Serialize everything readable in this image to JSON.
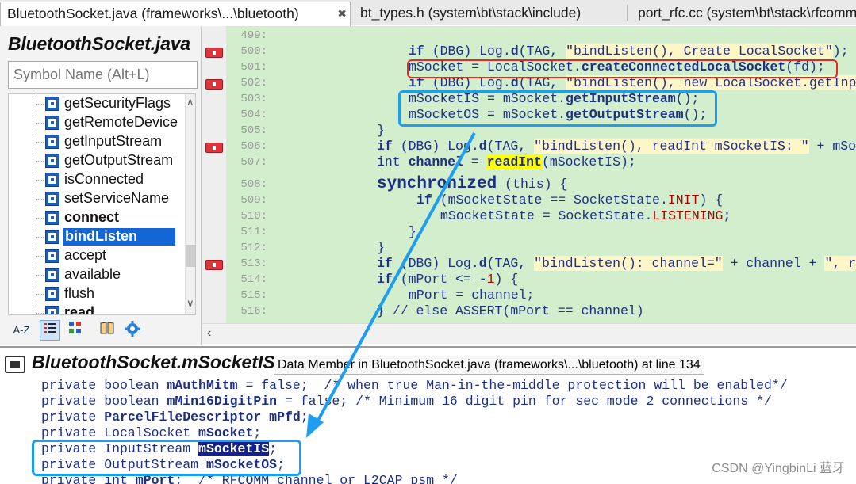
{
  "tabs": [
    {
      "label": "BluetoothSocket.java (frameworks\\...\\bluetooth)",
      "active": true,
      "close": "✖"
    },
    {
      "label": "bt_types.h (system\\bt\\stack\\include)",
      "active": false
    },
    {
      "label": "port_rfc.cc (system\\bt\\stack\\rfcomm)",
      "active": false
    }
  ],
  "symbols": {
    "title": "BluetoothSocket.java",
    "search_placeholder": "Symbol Name (Alt+L)",
    "items": [
      {
        "label": "getSecurityFlags",
        "bold": false
      },
      {
        "label": "getRemoteDevice",
        "bold": false
      },
      {
        "label": "getInputStream",
        "bold": false
      },
      {
        "label": "getOutputStream",
        "bold": false
      },
      {
        "label": "isConnected",
        "bold": false
      },
      {
        "label": "setServiceName",
        "bold": false
      },
      {
        "label": "connect",
        "bold": true
      },
      {
        "label": "bindListen",
        "bold": true,
        "selected": true
      },
      {
        "label": "accept",
        "bold": false
      },
      {
        "label": "available",
        "bold": false
      },
      {
        "label": "flush",
        "bold": false
      },
      {
        "label": "read",
        "bold": true
      }
    ],
    "toolbar": {
      "az": "A-Z",
      "up": "∧",
      "down": "∨",
      "left": "‹"
    }
  },
  "editor": {
    "lines": [
      {
        "no": "499:",
        "segs": []
      },
      {
        "no": "500:",
        "segs": [
          [
            "kw",
            "if"
          ],
          [
            "plain",
            " (DBG) "
          ],
          [
            "plain",
            "Log."
          ],
          [
            "fn",
            "d"
          ],
          [
            "plain",
            "(TAG, "
          ],
          [
            "str",
            "\"bindListen(), Create LocalSocket\""
          ],
          [
            "plain",
            ");"
          ]
        ]
      },
      {
        "no": "501:",
        "segs": [
          [
            "plain",
            "mSocket = LocalSocket."
          ],
          [
            "fn",
            "createConnectedLocalSocket"
          ],
          [
            "plain",
            "(fd);"
          ]
        ]
      },
      {
        "no": "502:",
        "segs": [
          [
            "kw",
            "if"
          ],
          [
            "plain",
            " (DBG) Log."
          ],
          [
            "fn",
            "d"
          ],
          [
            "plain",
            "(TAG, "
          ],
          [
            "str",
            "\"bindListen(), new LocalSocket.getInp"
          ]
        ]
      },
      {
        "no": "503:",
        "segs": [
          [
            "plain",
            "mSocketIS = mSocket."
          ],
          [
            "fn",
            "getInputStream"
          ],
          [
            "plain",
            "();"
          ]
        ]
      },
      {
        "no": "504:",
        "segs": [
          [
            "plain",
            "mSocketOS = mSocket."
          ],
          [
            "fn",
            "getOutputStream"
          ],
          [
            "plain",
            "();"
          ]
        ]
      },
      {
        "no": "505:",
        "segs": [
          [
            "plain",
            "}"
          ]
        ]
      },
      {
        "no": "506:",
        "segs": [
          [
            "kw",
            "if"
          ],
          [
            "plain",
            " (DBG) Log."
          ],
          [
            "fn",
            "d"
          ],
          [
            "plain",
            "(TAG, "
          ],
          [
            "str",
            "\"bindListen(), readInt mSocketIS: \""
          ],
          [
            "plain",
            " + mSo"
          ]
        ]
      },
      {
        "no": "507:",
        "segs": [
          [
            "plain",
            "int "
          ],
          [
            "kw",
            "channel"
          ],
          [
            "plain",
            " = "
          ],
          [
            "hl",
            "readInt"
          ],
          [
            "plain",
            "(mSocketIS);"
          ]
        ]
      },
      {
        "no": "508:",
        "segs": [
          [
            "sync",
            "synchronized"
          ],
          [
            "plain",
            " (this) {"
          ]
        ]
      },
      {
        "no": "509:",
        "segs": [
          [
            "kw",
            "if"
          ],
          [
            "plain",
            " (mSocketState == SocketState."
          ],
          [
            "const",
            "INIT"
          ],
          [
            "plain",
            ") {"
          ]
        ]
      },
      {
        "no": "510:",
        "segs": [
          [
            "plain",
            "mSocketState = SocketState."
          ],
          [
            "const",
            "LISTENING"
          ],
          [
            "plain",
            ";"
          ]
        ]
      },
      {
        "no": "511:",
        "segs": [
          [
            "plain",
            "}"
          ]
        ]
      },
      {
        "no": "512:",
        "segs": [
          [
            "plain",
            "}"
          ]
        ]
      },
      {
        "no": "513:",
        "segs": [
          [
            "kw",
            "if"
          ],
          [
            "plain",
            " (DBG) Log."
          ],
          [
            "fn",
            "d"
          ],
          [
            "plain",
            "(TAG, "
          ],
          [
            "str",
            "\"bindListen(): channel=\""
          ],
          [
            "plain",
            " + channel + "
          ],
          [
            "str",
            "\", r"
          ]
        ]
      },
      {
        "no": "514:",
        "segs": [
          [
            "kw",
            "if"
          ],
          [
            "plain",
            " (mPort <= -"
          ],
          [
            "const",
            "1"
          ],
          [
            "plain",
            ") {"
          ]
        ]
      },
      {
        "no": "515:",
        "segs": [
          [
            "plain",
            "mPort = channel;"
          ]
        ]
      },
      {
        "no": "516:",
        "segs": [
          [
            "plain",
            "} // else ASSERT(mPort == channel)"
          ]
        ]
      }
    ]
  },
  "context": {
    "title": "BluetoothSocket.mSocketIS",
    "info": "Data Member in BluetoothSocket.java (frameworks\\...\\bluetooth) at line 134",
    "lines": [
      [
        [
          "plain",
          "private boolean "
        ],
        [
          "bold",
          "mAuthMitm"
        ],
        [
          "plain",
          " = false;  /* when true Man-in-the-middle protection will be enabled*/"
        ]
      ],
      [
        [
          "plain",
          "private boolean "
        ],
        [
          "bold",
          "mMin16DigitPin"
        ],
        [
          "plain",
          " = false; /* Minimum 16 digit pin for sec mode 2 connections */"
        ]
      ],
      [
        [
          "plain",
          "private "
        ],
        [
          "bold",
          "ParcelFileDescriptor"
        ],
        [
          "plain",
          " "
        ],
        [
          "bold",
          "mPfd"
        ],
        [
          "plain",
          ";"
        ]
      ],
      [
        [
          "plain",
          "private LocalSocket "
        ],
        [
          "bold",
          "mSocket"
        ],
        [
          "plain",
          ";"
        ]
      ],
      [
        [
          "plain",
          "private InputStream "
        ],
        [
          "sel",
          "mSocketIS"
        ],
        [
          "plain",
          ";"
        ]
      ],
      [
        [
          "plain",
          "private OutputStream "
        ],
        [
          "bold",
          "mSocketOS"
        ],
        [
          "plain",
          ";"
        ]
      ],
      [
        [
          "plain",
          "private int "
        ],
        [
          "bold",
          "mPort"
        ],
        [
          "plain",
          ";  /* RFCOMM channel or L2CAP psm */"
        ]
      ]
    ]
  },
  "watermark": "CSDN @YingbinLi 蓝牙",
  "colors": {
    "red_box": "#e42a1d",
    "blue_box": "#1f9ef0",
    "editor_bg": "#d2eecd",
    "selection": "#1366d6"
  }
}
